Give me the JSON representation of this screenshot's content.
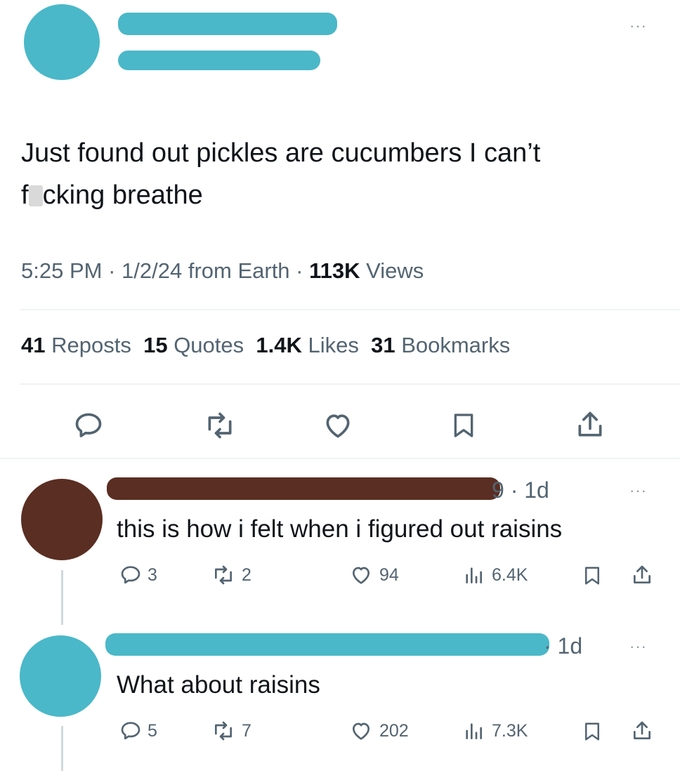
{
  "tweet": {
    "author_avatar_color": "#4ab8c8",
    "text_line1": "Just found out pickles are cucumbers I can’t",
    "text_line2_pre": "f",
    "text_line2_post": "cking breathe",
    "time": "5:25 PM",
    "date": "1/2/24",
    "source": "from Earth",
    "views_count": "113K",
    "views_label": "Views",
    "stats": {
      "reposts_count": "41",
      "reposts_label": "Reposts",
      "quotes_count": "15",
      "quotes_label": "Quotes",
      "likes_count": "1.4K",
      "likes_label": "Likes",
      "bookmarks_count": "31",
      "bookmarks_label": "Bookmarks"
    }
  },
  "replies": [
    {
      "avatar_color": "#5a2e22",
      "handle_tail": "9",
      "age": "· 1d",
      "text": "this is how i felt when i figured out raisins",
      "replies": "3",
      "reposts": "2",
      "likes": "94",
      "views": "6.4K"
    },
    {
      "avatar_color": "#4ab8c8",
      "age": "· 1d",
      "text": "What about raisins",
      "replies": "5",
      "reposts": "7",
      "likes": "202",
      "views": "7.3K"
    }
  ],
  "more_label": "···"
}
